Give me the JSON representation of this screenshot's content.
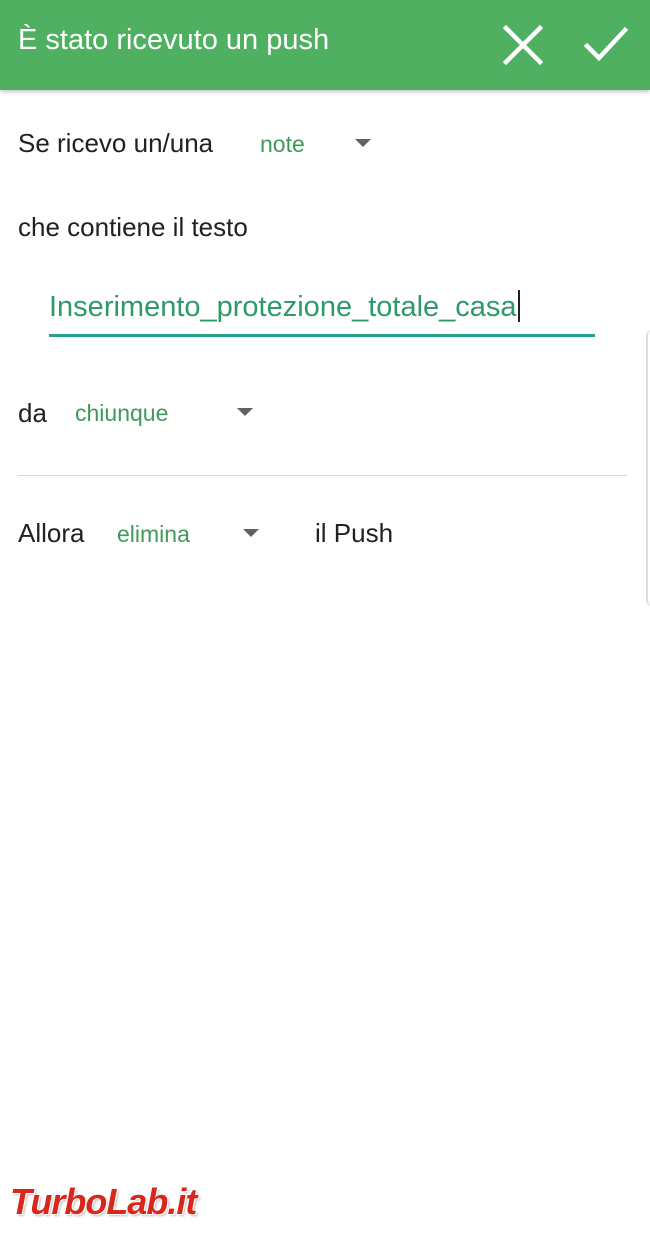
{
  "appbar": {
    "title": "È stato ricevuto un push",
    "close_icon": "close-icon",
    "confirm_icon": "check-icon",
    "color": "#4fb062"
  },
  "form": {
    "trigger_label": "Se ricevo un/una",
    "trigger_type": "note",
    "contains_label": "che contiene il testo",
    "text_value": "Inserimento_protezione_totale_casa",
    "sender_label": "da",
    "sender_value": "chiunque",
    "action_label": "Allora",
    "action_value": "elimina",
    "action_suffix": "il Push"
  },
  "colors": {
    "accent_green": "#3f9a58",
    "field_underline": "#2ba08c"
  },
  "watermark": "TurboLab.it"
}
